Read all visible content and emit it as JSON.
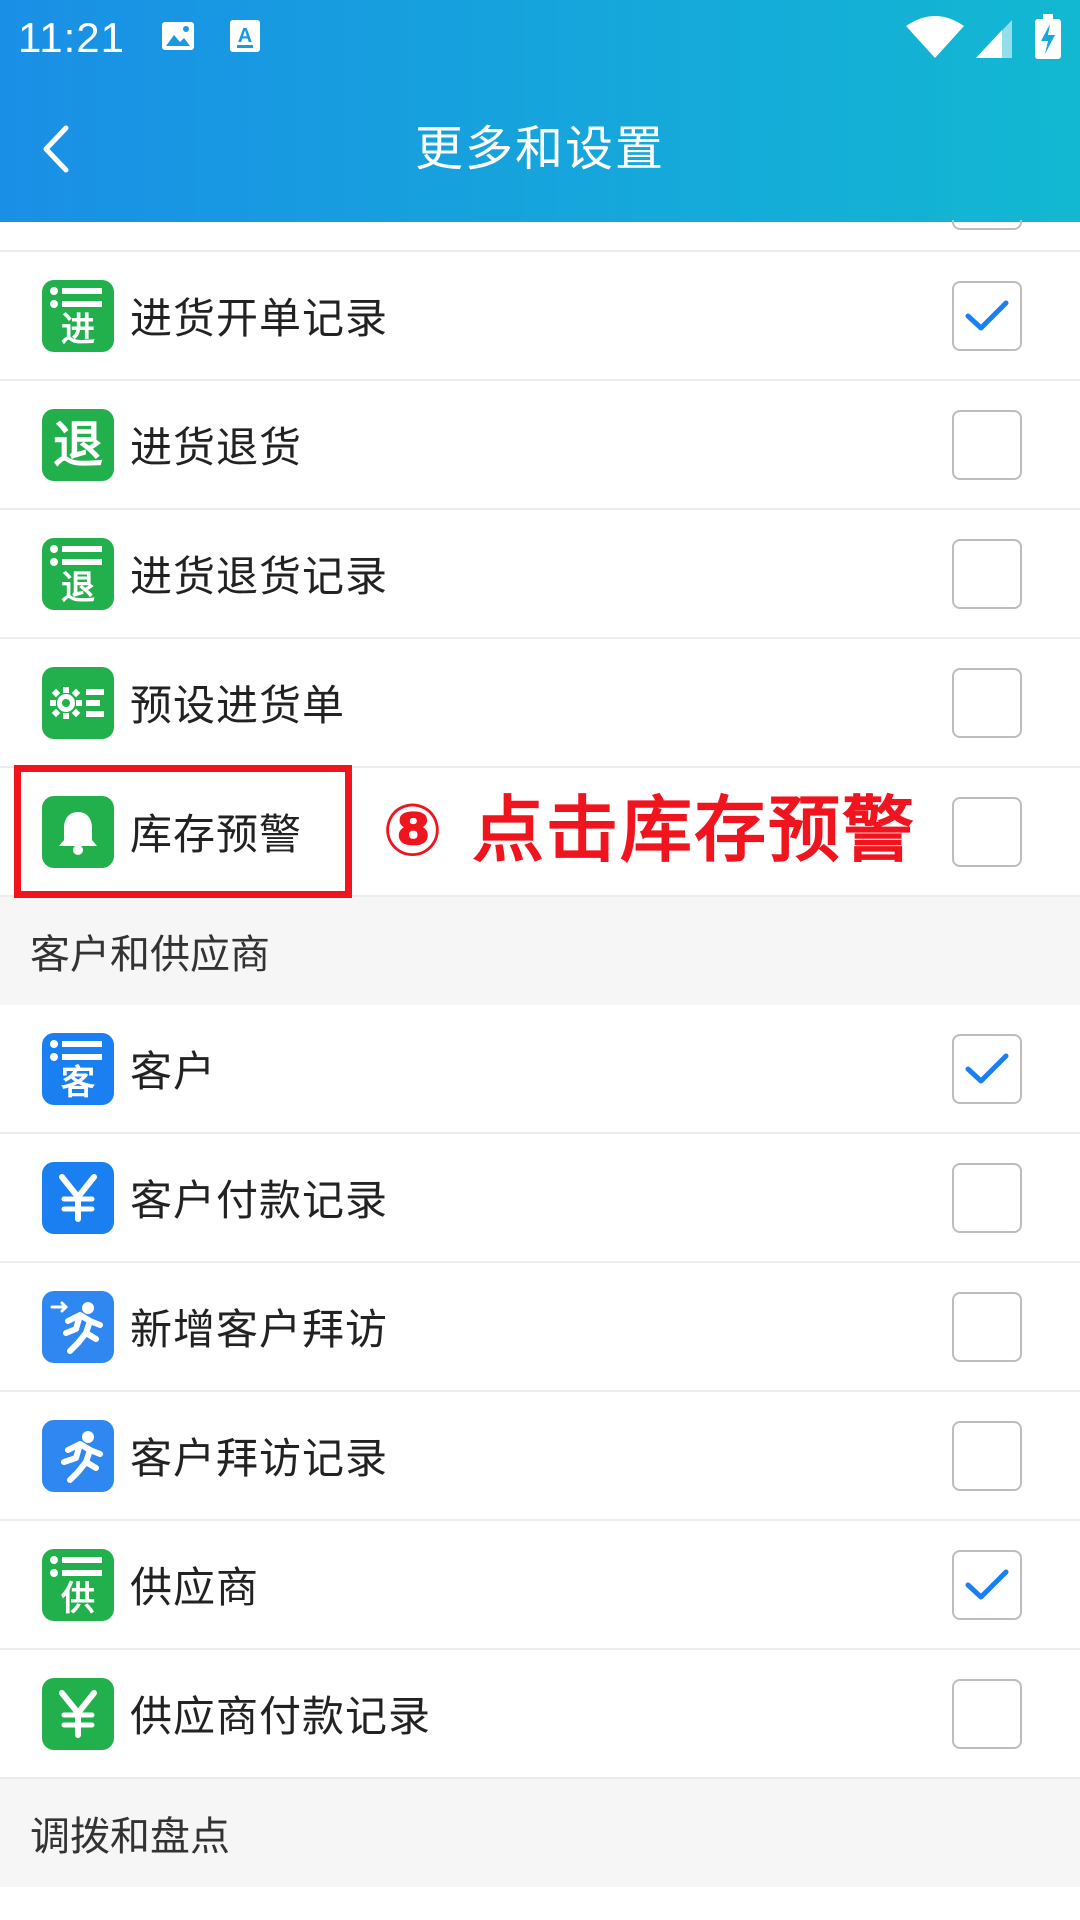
{
  "status_bar": {
    "time": "11:21",
    "left_icons": [
      "image-icon",
      "text-a-icon"
    ],
    "right_icons": [
      "wifi-icon",
      "cell-signal-icon",
      "battery-charging-icon"
    ]
  },
  "toolbar": {
    "title": "更多和设置",
    "back_icon": "chevron-left-icon"
  },
  "colors": {
    "header_gradient_start": "#1a8fe6",
    "header_gradient_end": "#12b8d2",
    "green_icon": "#21b04b",
    "blue_icon": "#1a7ff0",
    "check_color": "#1a7ff0",
    "annotation_red": "#f0141e"
  },
  "group_purchase": {
    "items": [
      {
        "label": "进货开单记录",
        "icon": "list-jin-icon",
        "icon_char": "进",
        "checked": true
      },
      {
        "label": "进货退货",
        "icon": "tui-icon",
        "icon_char": "退",
        "checked": false
      },
      {
        "label": "进货退货记录",
        "icon": "list-tui-icon",
        "icon_char": "退",
        "checked": false
      },
      {
        "label": "预设进货单",
        "icon": "gear-list-icon",
        "checked": false
      },
      {
        "label": "库存预警",
        "icon": "bell-icon",
        "checked": false
      }
    ]
  },
  "annotation": {
    "text": "⑧ 点击库存预警"
  },
  "group_customer": {
    "header": "客户和供应商",
    "items": [
      {
        "label": "客户",
        "icon": "list-ke-icon",
        "icon_char": "客",
        "checked": true
      },
      {
        "label": "客户付款记录",
        "icon": "yen-icon",
        "checked": false
      },
      {
        "label": "新增客户拜访",
        "icon": "runner-arrow-icon",
        "checked": false
      },
      {
        "label": "客户拜访记录",
        "icon": "runner-icon",
        "checked": false
      },
      {
        "label": "供应商",
        "icon": "list-gong-icon",
        "icon_char": "供",
        "checked": true
      },
      {
        "label": "供应商付款记录",
        "icon": "yen-icon",
        "checked": false
      }
    ]
  },
  "group_transfer": {
    "header": "调拨和盘点"
  }
}
